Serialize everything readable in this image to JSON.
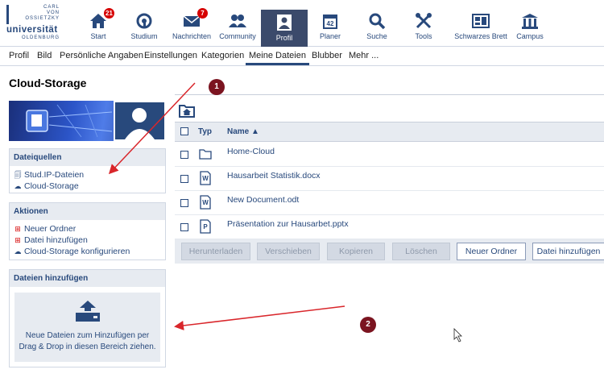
{
  "logo": {
    "line1": "CARL",
    "line2": "VON",
    "line3": "OSSIETZKY",
    "main": "universität",
    "sub": "OLDENBURG"
  },
  "nav": [
    {
      "label": "Start",
      "icon": "home-icon",
      "badge": "21"
    },
    {
      "label": "Studium",
      "icon": "studium-icon",
      "badge": ""
    },
    {
      "label": "Nachrichten",
      "icon": "mail-icon",
      "badge": "7"
    },
    {
      "label": "Community",
      "icon": "community-icon",
      "badge": ""
    },
    {
      "label": "Profil",
      "icon": "profile-icon",
      "badge": "",
      "active": true
    },
    {
      "label": "Planer",
      "icon": "calendar-icon",
      "badge": ""
    },
    {
      "label": "Suche",
      "icon": "search-icon",
      "badge": ""
    },
    {
      "label": "Tools",
      "icon": "tools-icon",
      "badge": ""
    },
    {
      "label": "Schwarzes Brett",
      "icon": "board-icon",
      "badge": ""
    },
    {
      "label": "Campus",
      "icon": "campus-icon",
      "badge": ""
    }
  ],
  "calendar_day": "42",
  "subnav": [
    "Profil",
    "Bild",
    "Persönliche Angaben",
    "Einstellungen",
    "Kategorien",
    "Meine Dateien",
    "Blubber",
    "Mehr ..."
  ],
  "page_title": "Cloud-Storage",
  "sidebar": {
    "sources_title": "Dateiquellen",
    "sources": [
      "Stud.IP-Dateien",
      "Cloud-Storage"
    ],
    "actions_title": "Aktionen",
    "actions": [
      "Neuer Ordner",
      "Datei hinzufügen",
      "Cloud-Storage konfigurieren"
    ],
    "add_title": "Dateien hinzufügen",
    "dropzone_text_1": "Neue Dateien zum Hinzufügen per",
    "dropzone_text_2": "Drag & Drop in diesen Bereich ziehen."
  },
  "table": {
    "col_type": "Typ",
    "col_name": "Name",
    "sort_indicator": "▲",
    "rows": [
      {
        "name": "Home-Cloud",
        "type": "folder"
      },
      {
        "name": "Hausarbeit Statistik.docx",
        "type": "word"
      },
      {
        "name": "New Document.odt",
        "type": "word"
      },
      {
        "name": "Präsentation zur Hausarbet.pptx",
        "type": "powerpoint"
      }
    ]
  },
  "buttons": {
    "download": "Herunterladen",
    "move": "Verschieben",
    "copy": "Kopieren",
    "delete": "Löschen",
    "new_folder": "Neuer Ordner",
    "add_file": "Datei hinzufügen"
  },
  "annotations": [
    "1",
    "2"
  ],
  "colors": {
    "brand": "#28497c",
    "header_gray": "#e7ebf1",
    "badge": "#d60000",
    "annotation_arrow": "#d9262b",
    "annotation_marker": "#7b1420"
  }
}
